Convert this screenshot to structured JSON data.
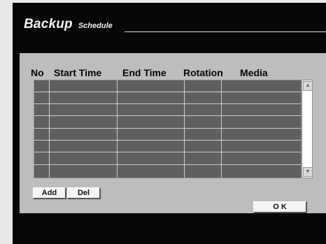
{
  "window": {
    "title": "Backup",
    "subtitle": "Schedule"
  },
  "table": {
    "columns": [
      "No",
      "Start Time",
      "End Time",
      "Rotation",
      "Media"
    ],
    "row_count": 8
  },
  "buttons": {
    "add": "Add",
    "del": "Del",
    "ok": "O K"
  },
  "icons": {
    "scroll_up": "arrow-up-icon",
    "scroll_down": "arrow-down-icon"
  },
  "colors": {
    "background": "#070707",
    "panel": "#bdbdbd",
    "grid": "#5f5f5f"
  }
}
